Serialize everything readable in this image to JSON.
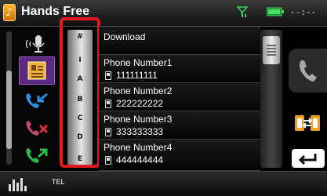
{
  "header": {
    "title": "Hands Free",
    "clock": "--:--"
  },
  "index_letters": [
    "#",
    "I",
    "A",
    "B",
    "C",
    "D",
    "E"
  ],
  "list": {
    "download_label": "Download",
    "contacts": [
      {
        "name": "Phone Number1",
        "number": "111111111"
      },
      {
        "name": "Phone Number2",
        "number": "222222222"
      },
      {
        "name": "Phone Number3",
        "number": "333333333"
      },
      {
        "name": "Phone Number4",
        "number": "444444444"
      }
    ]
  },
  "footer": {
    "source_label": "TEL"
  },
  "icons": {
    "app": "music-note-icon",
    "signal": "signal-strength-icon",
    "battery": "battery-icon",
    "voice": "voice-recognition-icon",
    "phonebook": "phonebook-icon",
    "incoming": "incoming-call-icon",
    "missed": "missed-call-icon",
    "outgoing": "outgoing-call-icon",
    "call": "call-handset-icon",
    "transfer": "transfer-icon",
    "back": "back-arrow-icon",
    "eq": "equalizer-icon"
  },
  "colors": {
    "highlight_frame": "#e01a20",
    "phonebook_active": "#5b2a7e",
    "call_green": "#2bbf4a",
    "call_blue": "#2a8fe0",
    "missed_red": "#e0303a",
    "transfer_orange": "#f0a020"
  }
}
